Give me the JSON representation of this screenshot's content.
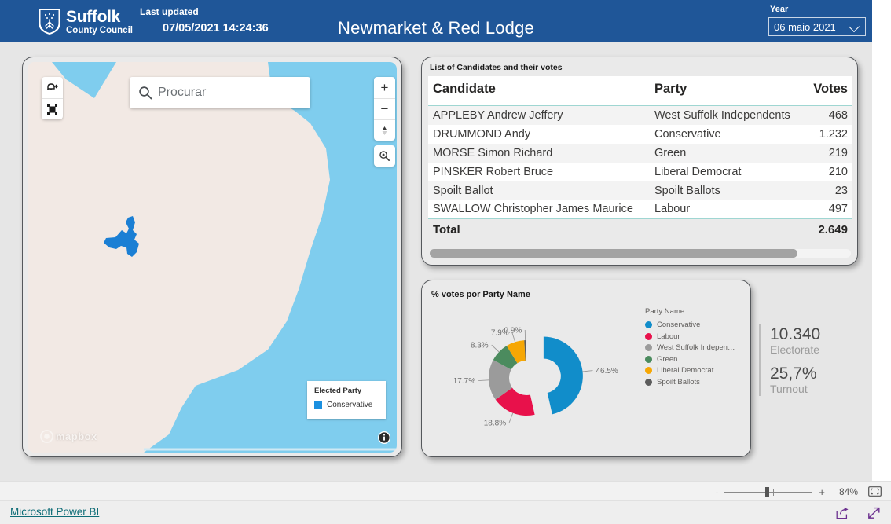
{
  "header": {
    "brand_line1": "Suffolk",
    "brand_line2": "County Council",
    "crest_icon": "suffolk-crest-icon",
    "last_updated_label": "Last updated",
    "last_updated_value": "07/05/2021 14:24:36",
    "title": "Newmarket & Red Lodge",
    "year_label": "Year",
    "year_value": "06 maio 2021",
    "chevron_icon": "chevron-down-icon",
    "background_color": "#1f5698"
  },
  "map": {
    "search_placeholder": "Procurar",
    "search_value": "",
    "search_icon": "search-icon",
    "tool_measure_icon": "measure-icon",
    "tool_fullscreen_icon": "expand-map-icon",
    "zoom_in_label": "+",
    "zoom_out_label": "−",
    "compass_icon": "compass-icon",
    "locate_icon": "magnifier-locate-icon",
    "attribution": "mapbox",
    "attribution_icon": "mapbox-logo-icon",
    "info_icon": "info-icon",
    "legend": {
      "title": "Elected Party",
      "items": [
        {
          "label": "Conservative",
          "color": "#1b90e0"
        }
      ]
    },
    "colors": {
      "land": "#f2e9e4",
      "water": "#7fcdee",
      "district": "#1b7fd4"
    }
  },
  "table": {
    "title": "List of Candidates and their votes",
    "columns": [
      "Candidate",
      "Party",
      "Votes"
    ],
    "rows": [
      {
        "candidate": "APPLEBY Andrew Jeffery",
        "party": "West Suffolk Independents",
        "votes": "468"
      },
      {
        "candidate": "DRUMMOND Andy",
        "party": "Conservative",
        "votes": "1.232"
      },
      {
        "candidate": "MORSE Simon Richard",
        "party": "Green",
        "votes": "219"
      },
      {
        "candidate": "PINSKER Robert Bruce",
        "party": "Liberal Democrat",
        "votes": "210"
      },
      {
        "candidate": "Spoilt Ballot",
        "party": "Spoilt Ballots",
        "votes": "23"
      },
      {
        "candidate": "SWALLOW Christopher James Maurice",
        "party": "Labour",
        "votes": "497"
      }
    ],
    "total_label": "Total",
    "total_votes": "2.649"
  },
  "chart_data": {
    "type": "pie",
    "title": "% votes por Party Name",
    "legend_title": "Party Name",
    "legend_position": "right",
    "categories": [
      "Conservative",
      "Labour",
      "West Suffolk Independents",
      "Green",
      "Liberal Democrat",
      "Spoilt Ballots"
    ],
    "legend_labels": [
      "Conservative",
      "Labour",
      "West Suffolk Indepen…",
      "Green",
      "Liberal Democrat",
      "Spoilt Ballots"
    ],
    "values": [
      46.5,
      18.8,
      17.7,
      8.3,
      7.9,
      0.9
    ],
    "data_labels": [
      "46.5%",
      "18.8%",
      "17.7%",
      "8.3%",
      "7.9%",
      "0.9%"
    ],
    "colors": [
      "#118DCA",
      "#E8114B",
      "#9B9B9B",
      "#4B8B5E",
      "#F6A704",
      "#5C5C5C"
    ],
    "exploded_slice": "Conservative",
    "xlabel": "",
    "ylabel": ""
  },
  "kpis": [
    {
      "value": "10.340",
      "label": "Electorate"
    },
    {
      "value": "25,7%",
      "label": "Turnout"
    }
  ],
  "statusbar": {
    "zoom_minus": "-",
    "zoom_plus": "+",
    "zoom_percent": "84%",
    "fit_icon": "fit-to-page-icon"
  },
  "footer": {
    "powerbi_link": "Microsoft Power BI",
    "share_icon": "share-icon",
    "fullscreen_icon": "fullscreen-icon"
  }
}
